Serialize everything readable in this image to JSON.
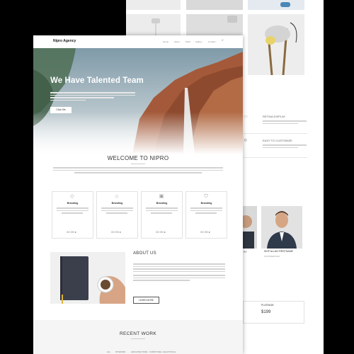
{
  "front": {
    "brand": "Nipro Agency",
    "nav": [
      "Home",
      "About",
      "Work",
      "Gallery",
      "Contact"
    ],
    "hero": {
      "title": "We Have Talented Team",
      "button": "Click Me"
    },
    "welcome_title": "WELCOME TO NIPRO",
    "cards": [
      {
        "title": "Branding",
        "link": "GO ON"
      },
      {
        "title": "Branding",
        "link": "GO ON"
      },
      {
        "title": "Branding",
        "link": "GO ON"
      },
      {
        "title": "Branding",
        "link": "GO ON"
      }
    ],
    "about": {
      "title": "ABOUT US",
      "button": "LEARN MORE"
    },
    "recent_work": {
      "title": "RECENT WORK",
      "filters": [
        "ALL",
        "INTERIOR",
        "ARCHITECTURE",
        "FURNITURE",
        "ELECTRICAL"
      ]
    }
  },
  "back": {
    "features": [
      "RETINA DISPLAY",
      "EASY TO CUSTOMIZE"
    ],
    "team_member": {
      "name": "SKIP ALLAN FIRSTNAME",
      "role": "FOUNDER/CEO"
    },
    "pricing": {
      "plan": "PLATINUM",
      "price": "$199"
    }
  }
}
